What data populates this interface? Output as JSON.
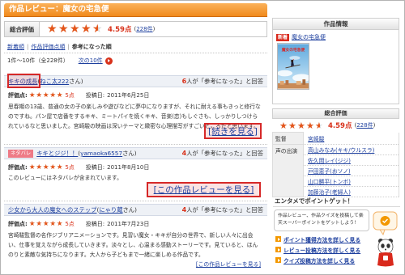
{
  "page": {
    "title": "作品レビュー：魔女の宅急便"
  },
  "overall": {
    "label": "総合評価",
    "stars": 4.5,
    "score": "4.59点",
    "count_open": "(",
    "count": "228件",
    "count_close": ")"
  },
  "sort": {
    "separator": "|",
    "options": [
      {
        "label": "新着順"
      },
      {
        "label": "作品評価点順"
      },
      {
        "label": "参考になった順"
      }
    ]
  },
  "pagination": {
    "range": "1件～10件（全228件）",
    "next": "次の10件"
  },
  "labels": {
    "rating": "評価点:",
    "posted": "投稿日:",
    "reviewer_open": "(",
    "reviewer_close": "さん)"
  },
  "reviews": [
    {
      "title": "キキの成長",
      "reviewer": "ねこ太222",
      "helpful_count": "6",
      "helpful_text": "人が「参考になった」と回答",
      "stars": 5,
      "score": "5点",
      "date": "2011年6月25日",
      "body": "思春期の13歳、普通の女の子の楽しみや遊びなどに夢中になりますが、それに耐える事もきっと修行なのですね。パン屋で店番をするキキ、ミートパイを焼くキキ、音楽(恋)もしぐさも、しっかりしつけられているなと思いました。宮崎駿の映画は深いテーマと緻密な心理描写がすごいところだと思います。",
      "more": "[続きを見る]"
    },
    {
      "badge": "ネタバレ",
      "title": "キキとジジ！！",
      "reviewer": "yamaoka6557",
      "helpful_count": "4",
      "helpful_text": "人が「参考になった」と回答",
      "stars": 5,
      "score": "5点",
      "date": "2011年8月10日",
      "body": "このレビューにはネタバレが含まれています。",
      "more": "[この作品レビューを見る]"
    },
    {
      "title": "少女から大人の魔女へのステップ",
      "reviewer": "にゃり蔵",
      "helpful_count": "4",
      "helpful_text": "人が「参考になった」と回答",
      "stars": 5,
      "score": "5点",
      "date": "2011年7月23日",
      "body": "宮崎駿監督の名作ジブリアニメーションです。見習い魔女・キキが自分の世界で、新しい人々に出会い、仕事を覚えながら成長していきます。淡々とし、心温まる感動ストーリーです。見ていると、ほんのりと素敵な気持ちになります。大人から子どもまで一緒に楽しめる作品です。",
      "more": "[この作品レビューを見る]"
    }
  ],
  "sidebar": {
    "title": "作品情報",
    "new_badge": "新着",
    "work_title": "魔女の宅急便",
    "cover_lettering": "魔女の宅急便",
    "rating_header": "総合評価",
    "stars": 4.5,
    "score": "4.59点",
    "count_open": "(",
    "count": "228件",
    "count_close": ")",
    "credits": [
      {
        "role": "監督",
        "names": [
          "宮崎駿"
        ]
      },
      {
        "role": "声の出演",
        "names": [
          "高山みなみ(キキ/ウルスラ)",
          "佐久間レイ(ジジ)",
          "戸田恵子(おソノ)",
          "山口勝平(トンボ)",
          "加藤治子(老婦人)"
        ]
      }
    ]
  },
  "promo": {
    "title": "エンタメでポイントゲット！",
    "text": "作品レビュー、作品クイズを投稿して楽天スーパーポイントをゲットしよう！",
    "links": [
      "ポイント獲得方法を詳しく見る",
      "レビュー投稿方法を詳しく見る",
      "クイズ投稿方法を詳しく見る"
    ]
  },
  "icons": {
    "star": "star-icon",
    "next": "next-arrow-icon",
    "link_arrow": "orange-arrow-icon"
  },
  "colors": {
    "accent": "#f08a1c",
    "link": "#1d3f9e",
    "score_red": "#d8311a",
    "star": "#e4551a",
    "highlight": "#d62828",
    "spoiler_badge": "#ee7a86"
  }
}
